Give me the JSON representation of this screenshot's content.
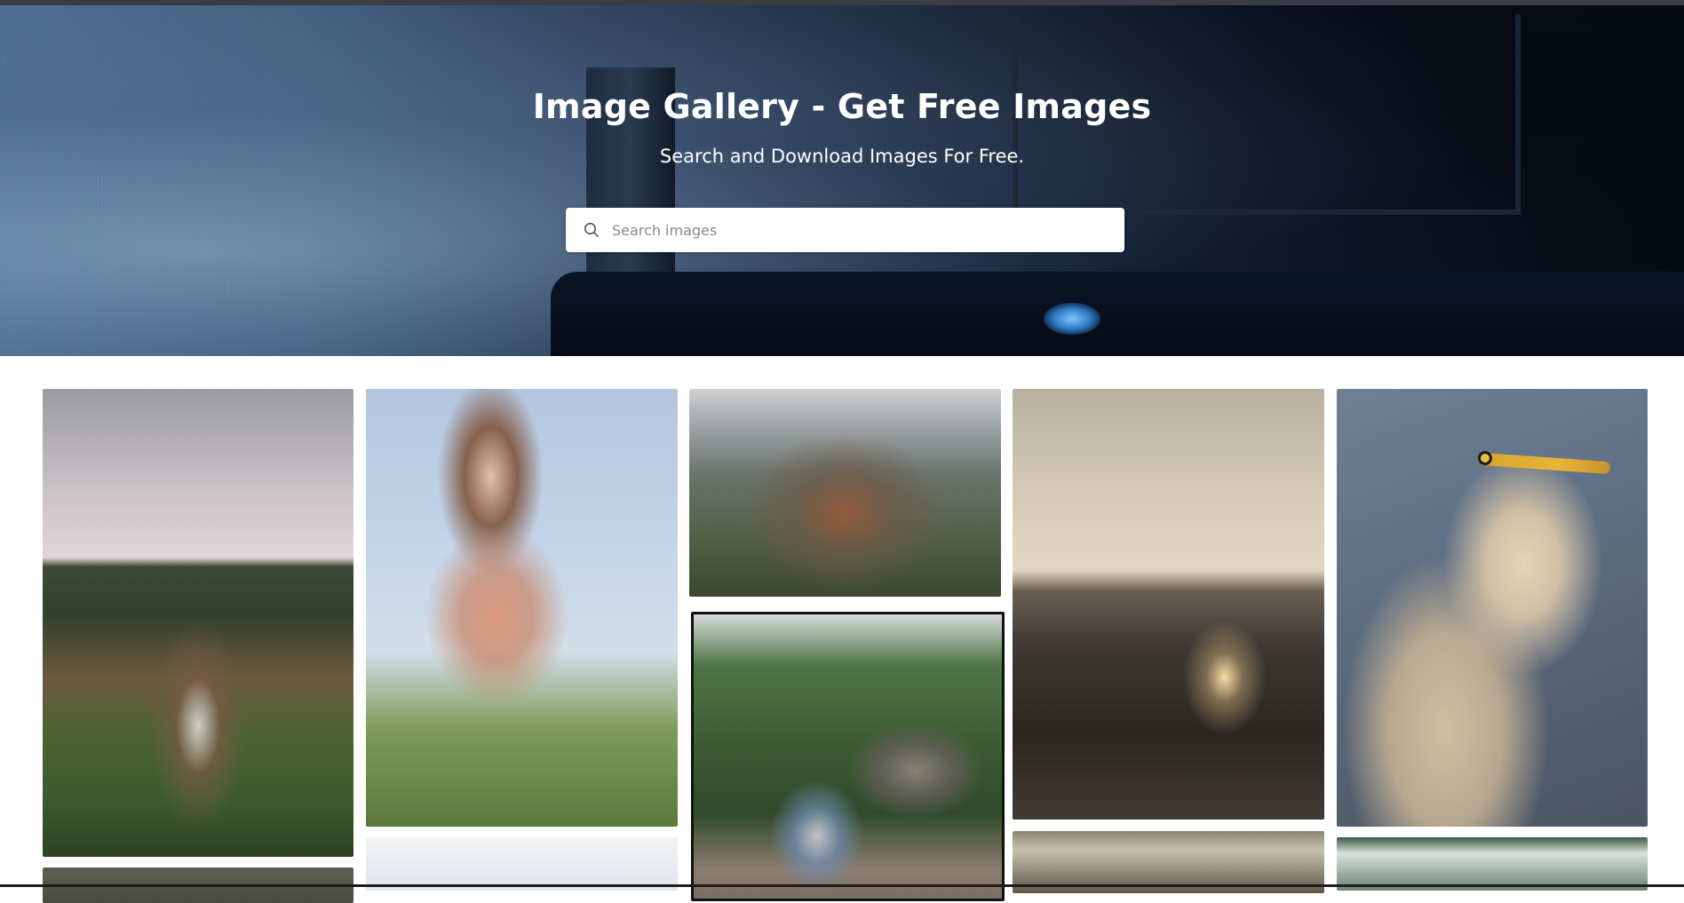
{
  "hero": {
    "title": "Image Gallery - Get Free Images",
    "subtitle": "Search and Download Images For Free."
  },
  "search": {
    "placeholder": "Search images",
    "value": "",
    "icon": "search-icon"
  },
  "gallery": {
    "images": [
      {
        "subject": "couple-with-flowers"
      },
      {
        "subject": "girl-in-pink-sweater"
      },
      {
        "subject": "misty-mountain"
      },
      {
        "subject": "boy-in-overalls"
      },
      {
        "subject": "birds-over-station"
      },
      {
        "subject": "white-heron"
      }
    ]
  },
  "colors": {
    "hero_text": "#ffffff",
    "page_background": "#ffffff"
  }
}
